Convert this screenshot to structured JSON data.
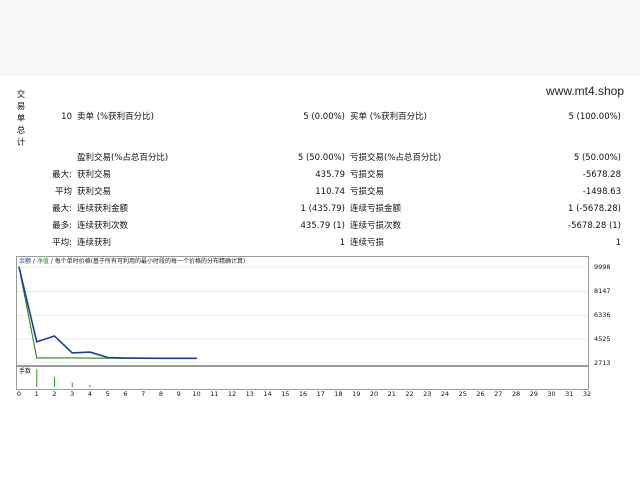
{
  "watermark": "www.mt4.shop",
  "side_label": [
    "交",
    "易",
    "单",
    "总",
    "计"
  ],
  "stats": {
    "r1": {
      "count": "10",
      "l1": "卖单 (%获利百分比)",
      "v1": "5 (0.00%)",
      "l2": "买单 (%获利百分比)",
      "v2": "5 (100.00%)"
    },
    "r2": {
      "l1": "盈利交易(%占总百分比)",
      "v1": "5 (50.00%)",
      "l2": "亏损交易(%占总百分比)",
      "v2": "5 (50.00%)"
    },
    "r3": {
      "prefix": "最大:",
      "l1": "获利交易",
      "v1": "435.79",
      "l2": "亏损交易",
      "v2": "-5678.28"
    },
    "r4": {
      "prefix": "平均",
      "l1": "获利交易",
      "v1": "110.74",
      "l2": "亏损交易",
      "v2": "-1498.63"
    },
    "r5": {
      "prefix": "最大:",
      "l1": "连续获利金额",
      "v1": "1 (435.79)",
      "l2": "连续亏损金额",
      "v2": "1 (-5678.28)"
    },
    "r6": {
      "prefix": "最多:",
      "l1": "连续获利次数",
      "v1": "435.79 (1)",
      "l2": "连续亏损次数",
      "v2": "-5678.28 (1)"
    },
    "r7": {
      "prefix": "平均:",
      "l1": "连续获利",
      "v1": "1",
      "l2": "连续亏损",
      "v2": "1"
    }
  },
  "chart_legend": {
    "balance": "余额",
    "sep1": " / ",
    "equity": "净值",
    "sep2": " / ",
    "desc": "每个单时价格(基于所有可利用的最小时段的每一个价格的分布精确计算)"
  },
  "lot_label": "手数",
  "colors": {
    "balance": "#1c3c9a",
    "equity": "#1e8e1e",
    "grid": "#d8d8d8",
    "lots": "#2a9a2a"
  },
  "chart_data": {
    "type": "line",
    "ylim": [
      2713,
      9998
    ],
    "yticks": [
      9998,
      8147,
      6336,
      4525,
      2713
    ],
    "xlim": [
      0,
      32
    ],
    "xticks": [
      0,
      1,
      2,
      3,
      4,
      5,
      6,
      7,
      8,
      9,
      10,
      11,
      12,
      13,
      14,
      15,
      16,
      17,
      18,
      19,
      20,
      21,
      22,
      23,
      24,
      25,
      26,
      27,
      28,
      29,
      30,
      31,
      32
    ],
    "series": [
      {
        "name": "余额",
        "x": [
          0,
          1,
          2,
          3,
          4,
          5,
          6,
          7,
          8,
          9,
          10
        ],
        "values": [
          9998,
          4320,
          4760,
          3480,
          3540,
          3130,
          3090,
          3080,
          3070,
          3070,
          3070
        ]
      },
      {
        "name": "净值",
        "x": [
          0,
          1,
          2,
          3,
          4,
          5,
          6,
          7,
          8,
          9,
          10
        ],
        "values": [
          9998,
          3100,
          3100,
          3100,
          3090,
          3080,
          3070,
          3070,
          3070,
          3070,
          3070
        ]
      }
    ],
    "lots": {
      "x": [
        1,
        2,
        3,
        4
      ],
      "values": [
        1.0,
        0.55,
        0.25,
        0.12
      ]
    }
  }
}
